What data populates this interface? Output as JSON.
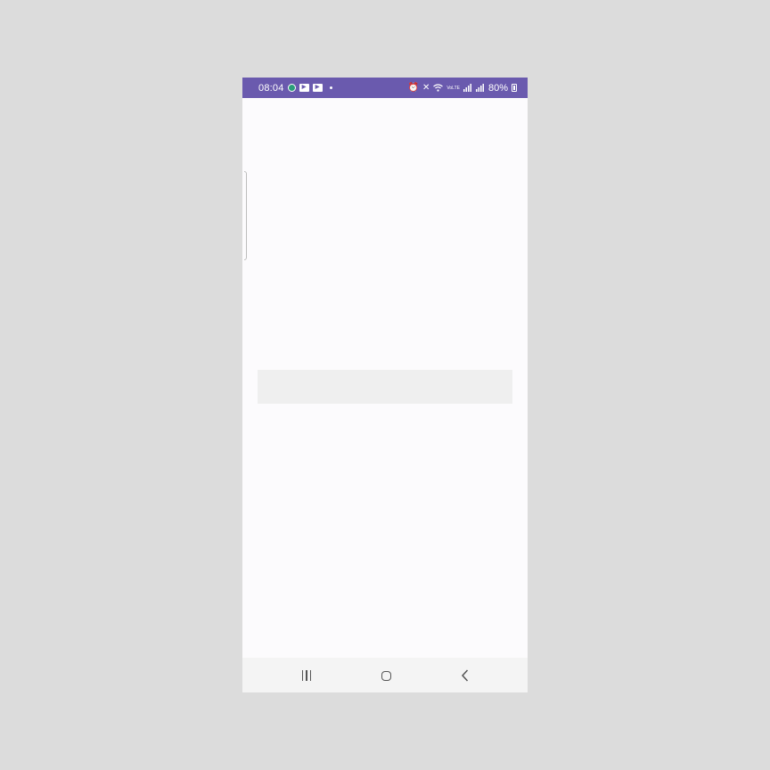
{
  "status_bar": {
    "time": "08:04",
    "notification_icons": [
      "app-icon",
      "video-icon",
      "video-icon",
      "dot-icon"
    ],
    "system_icons": [
      "alarm-icon",
      "mute-icon",
      "wifi-icon",
      "volte-icon",
      "signal-icon",
      "signal-icon"
    ],
    "volte_label": "VoLTE",
    "battery": "80%",
    "background_color": "#6a5aae"
  },
  "content": {
    "background_color": "#fcfbfd",
    "loading_placeholder_color": "#efefef"
  },
  "navigation_bar": {
    "buttons": [
      "recent-apps",
      "home",
      "back"
    ]
  }
}
